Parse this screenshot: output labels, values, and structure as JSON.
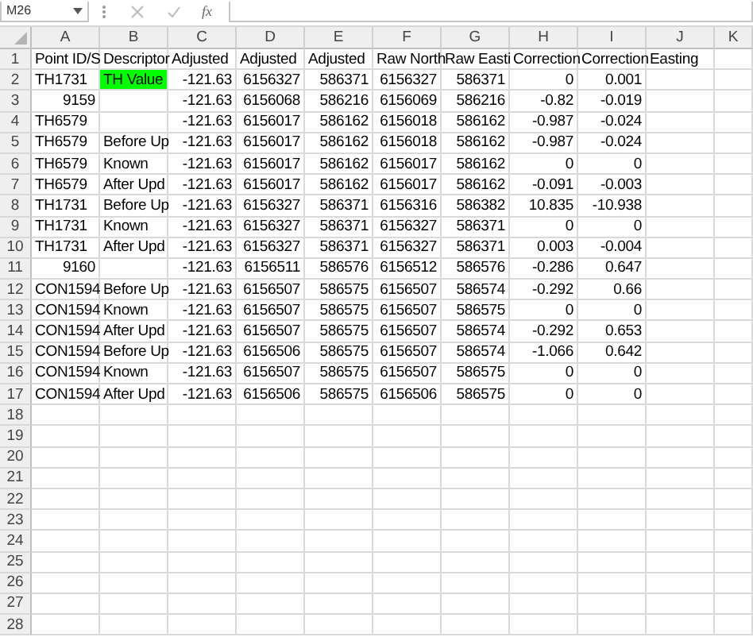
{
  "formula_bar": {
    "name_box": "M26",
    "function_label": "fx"
  },
  "columns": [
    {
      "letter": "A",
      "kind": "text"
    },
    {
      "letter": "B",
      "kind": "text"
    },
    {
      "letter": "C",
      "kind": "number"
    },
    {
      "letter": "D",
      "kind": "number"
    },
    {
      "letter": "E",
      "kind": "number"
    },
    {
      "letter": "F",
      "kind": "number"
    },
    {
      "letter": "G",
      "kind": "number"
    },
    {
      "letter": "H",
      "kind": "number"
    },
    {
      "letter": "I",
      "kind": "number"
    },
    {
      "letter": "J",
      "kind": "text"
    },
    {
      "letter": "K"
    }
  ],
  "rows": [
    {
      "number": "1",
      "cells": [
        {
          "text": "Point ID/S",
          "kind": "text"
        },
        {
          "text": "Descriptor",
          "kind": "text"
        },
        {
          "text": "Adjusted",
          "kind": "text"
        },
        {
          "text": "Adjusted",
          "kind": "text"
        },
        {
          "text": "Adjusted",
          "kind": "text"
        },
        {
          "text": "Raw North",
          "kind": "text"
        },
        {
          "text": "Raw Easti",
          "kind": "text"
        },
        {
          "text": "Correction",
          "kind": "text"
        },
        {
          "text": "Correction",
          "kind": "text"
        },
        {
          "text": "Easting",
          "kind": "text"
        },
        null
      ]
    },
    {
      "number": "2",
      "cells": [
        "TH1731",
        {
          "text": "TH Value",
          "kind": "text",
          "color": "#00ff00"
        },
        "-121.63",
        "6156327",
        "586371",
        "6156327",
        "586371",
        "0",
        "0.001",
        null,
        null
      ]
    },
    {
      "number": "3",
      "cells": [
        {
          "text": "9159",
          "kind": "number"
        },
        null,
        "-121.63",
        "6156068",
        "586216",
        "6156069",
        "586216",
        "-0.82",
        "-0.019",
        null,
        null
      ]
    },
    {
      "number": "4",
      "cells": [
        "TH6579",
        null,
        "-121.63",
        "6156017",
        "586162",
        "6156018",
        "586162",
        "-0.987",
        "-0.024",
        null,
        null
      ]
    },
    {
      "number": "5",
      "cells": [
        "TH6579",
        "Before Up",
        "-121.63",
        "6156017",
        "586162",
        "6156018",
        "586162",
        "-0.987",
        "-0.024",
        null,
        null
      ]
    },
    {
      "number": "6",
      "cells": [
        "TH6579",
        "Known",
        "-121.63",
        "6156017",
        "586162",
        "6156017",
        "586162",
        "0",
        "0",
        null,
        null
      ]
    },
    {
      "number": "7",
      "cells": [
        "TH6579",
        "After Upd",
        "-121.63",
        "6156017",
        "586162",
        "6156017",
        "586162",
        "-0.091",
        "-0.003",
        null,
        null
      ]
    },
    {
      "number": "8",
      "cells": [
        "TH1731",
        "Before Up",
        "-121.63",
        "6156327",
        "586371",
        "6156316",
        "586382",
        "10.835",
        "-10.938",
        null,
        null
      ]
    },
    {
      "number": "9",
      "cells": [
        "TH1731",
        "Known",
        "-121.63",
        "6156327",
        "586371",
        "6156327",
        "586371",
        "0",
        "0",
        null,
        null
      ]
    },
    {
      "number": "10",
      "cells": [
        "TH1731",
        "After Upd",
        "-121.63",
        "6156327",
        "586371",
        "6156327",
        "586371",
        "0.003",
        "-0.004",
        null,
        null
      ]
    },
    {
      "number": "11",
      "cells": [
        {
          "text": "9160",
          "kind": "number"
        },
        null,
        "-121.63",
        "6156511",
        "586576",
        "6156512",
        "586576",
        "-0.286",
        "0.647",
        null,
        null
      ]
    },
    {
      "number": "12",
      "cells": [
        "CON1594",
        "Before Up",
        "-121.63",
        "6156507",
        "586575",
        "6156507",
        "586574",
        "-0.292",
        "0.66",
        null,
        null
      ]
    },
    {
      "number": "13",
      "cells": [
        "CON1594",
        "Known",
        "-121.63",
        "6156507",
        "586575",
        "6156507",
        "586575",
        "0",
        "0",
        null,
        null
      ]
    },
    {
      "number": "14",
      "cells": [
        "CON1594",
        "After Upd",
        "-121.63",
        "6156507",
        "586575",
        "6156507",
        "586574",
        "-0.292",
        "0.653",
        null,
        null
      ]
    },
    {
      "number": "15",
      "cells": [
        "CON1594",
        "Before Up",
        "-121.63",
        "6156506",
        "586575",
        "6156507",
        "586574",
        "-1.066",
        "0.642",
        null,
        null
      ]
    },
    {
      "number": "16",
      "cells": [
        "CON1594",
        "Known",
        "-121.63",
        "6156507",
        "586575",
        "6156507",
        "586575",
        "0",
        "0",
        null,
        null
      ]
    },
    {
      "number": "17",
      "cells": [
        "CON1594",
        "After Upd",
        "-121.63",
        "6156506",
        "586575",
        "6156506",
        "586575",
        "0",
        "0",
        null,
        null
      ]
    },
    {
      "number": "18",
      "cells": []
    },
    {
      "number": "19",
      "cells": []
    },
    {
      "number": "20",
      "cells": []
    },
    {
      "number": "21",
      "cells": []
    },
    {
      "number": "22",
      "cells": []
    },
    {
      "number": "23",
      "cells": []
    },
    {
      "number": "24",
      "cells": []
    },
    {
      "number": "25",
      "cells": []
    },
    {
      "number": "26",
      "cells": []
    },
    {
      "number": "27",
      "cells": []
    },
    {
      "number": "28",
      "cells": []
    }
  ]
}
